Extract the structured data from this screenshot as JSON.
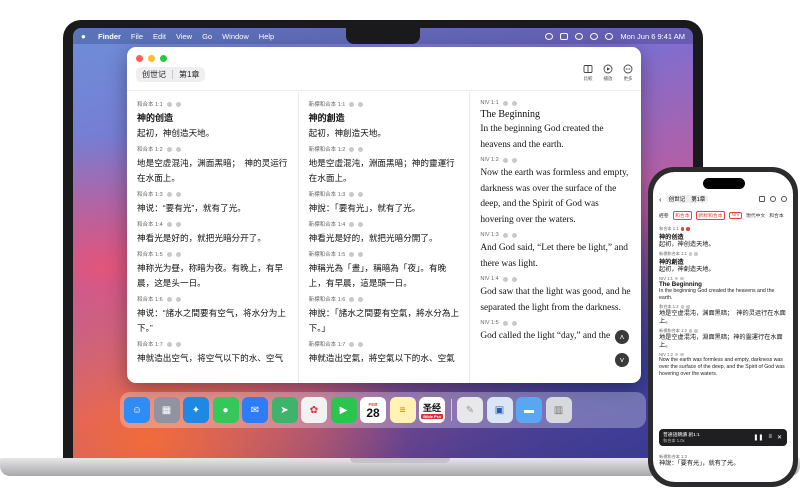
{
  "menubar": {
    "items": [
      "Finder",
      "File",
      "Edit",
      "View",
      "Go",
      "Window",
      "Help"
    ],
    "clock": "Mon Jun 6  9:41 AM"
  },
  "window": {
    "book": "创世记",
    "chapter": "第1章",
    "actions": [
      {
        "label": "比較",
        "icon": "columns-icon"
      },
      {
        "label": "播放",
        "icon": "play-circle-icon"
      },
      {
        "label": "更多",
        "icon": "more-circle-icon"
      }
    ],
    "columns": [
      {
        "verses": [
          {
            "ref": "和合本 1:1",
            "heading": "神的创造",
            "text": "起初，神创造天地。"
          },
          {
            "ref": "和合本 1:2",
            "text": "地是空虚混沌，渊面黑暗；　神的灵运行在水面上。"
          },
          {
            "ref": "和合本 1:3",
            "text": "神说：“要有光”，就有了光。"
          },
          {
            "ref": "和合本 1:4",
            "text": "神看光是好的，就把光暗分开了。"
          },
          {
            "ref": "和合本 1:5",
            "text": "神称光为昼，称暗为夜。有晚上，有早晨，这是头一日。"
          },
          {
            "ref": "和合本 1:6",
            "text": "神说：“諸水之間要有空气，将水分为上下。”"
          },
          {
            "ref": "和合本 1:7",
            "text": "神就造出空气，将空气以下的水、空气"
          }
        ]
      },
      {
        "verses": [
          {
            "ref": "新標和合本 1:1",
            "heading": "神的創造",
            "text": "起初，神創造天地。"
          },
          {
            "ref": "新標和合本 1:2",
            "text": "地是空虛混沌，淵面黑暗；神的靈運行在水面上。"
          },
          {
            "ref": "新標和合本 1:3",
            "text": "神說：「要有光」，就有了光。"
          },
          {
            "ref": "新標和合本 1:4",
            "text": "神看光是好的，就把光暗分開了。"
          },
          {
            "ref": "新標和合本 1:5",
            "text": "神稱光為「晝」，稱暗為「夜」。有晚上，有早晨，這是頭一日。"
          },
          {
            "ref": "新標和合本 1:6",
            "text": "神說：「諸水之間要有空氣，將水分為上下。」"
          },
          {
            "ref": "新標和合本 1:7",
            "text": "神就造出空氣，將空氣以下的水、空氣"
          }
        ]
      },
      {
        "verses": [
          {
            "ref": "NIV 1:1",
            "heading": "The Beginning",
            "text": "In the beginning God created the heavens and the earth."
          },
          {
            "ref": "NIV 1:2",
            "text": "Now the earth was formless and empty, darkness was over the surface of the deep, and the Spirit of God was hovering over the waters."
          },
          {
            "ref": "NIV 1:3",
            "text": "And God said, “Let there be light,” and there was light."
          },
          {
            "ref": "NIV 1:4",
            "text": "God saw that the light was good, and he separated the light from the darkness."
          },
          {
            "ref": "NIV 1:5",
            "text": "God called the light “day,” and the"
          }
        ]
      }
    ]
  },
  "dock": {
    "calendar_month": "FEB",
    "calendar_day": "28",
    "bible_app_label": "圣经",
    "bible_app_badge": "Bible Pro"
  },
  "phone": {
    "book": "创世记",
    "chapter": "第1章",
    "tabs": [
      "經卷",
      "和合本",
      "新标和合本",
      "NIV",
      "現代中文",
      "和合本"
    ],
    "blocks": [
      {
        "ref": "和合本 1:1",
        "heading": "神的创造",
        "text": "起初，神创造天地。",
        "style": "zh"
      },
      {
        "ref": "新標和合本 1:1",
        "heading": "神的創造",
        "text": "起初，神創造天地。",
        "style": "zh"
      },
      {
        "ref": "NIV 1:1",
        "heading": "The Beginning",
        "text": "In the beginning God created the heavens and the earth.",
        "style": "en"
      },
      {
        "ref": "和合本 1:2",
        "text": "地是空虚混沌，渊面黑暗；　神的灵运行在水面上。",
        "style": "zh"
      },
      {
        "ref": "新標和合本 1:2",
        "text": "地是空虛混沌，淵面黑暗；神的靈運行在水面上。",
        "style": "zh"
      },
      {
        "ref": "NIV 1:2",
        "text": "Now the earth was formless and empty, darkness was over the surface of the deep, and the Spirit of God was hovering over the waters.",
        "style": "en"
      }
    ],
    "player": {
      "title": "普通話朗讀 創1:1",
      "sub": "和合本 1.0x"
    },
    "bottom": [
      {
        "ref": "新標和合本 1:3",
        "text": "神說：「要有光」，就有了光。"
      }
    ]
  },
  "colors": {
    "accent": "#e2453c",
    "window_bg": "#ffffff",
    "dock_bg": "rgba(255,255,255,0.28)"
  }
}
